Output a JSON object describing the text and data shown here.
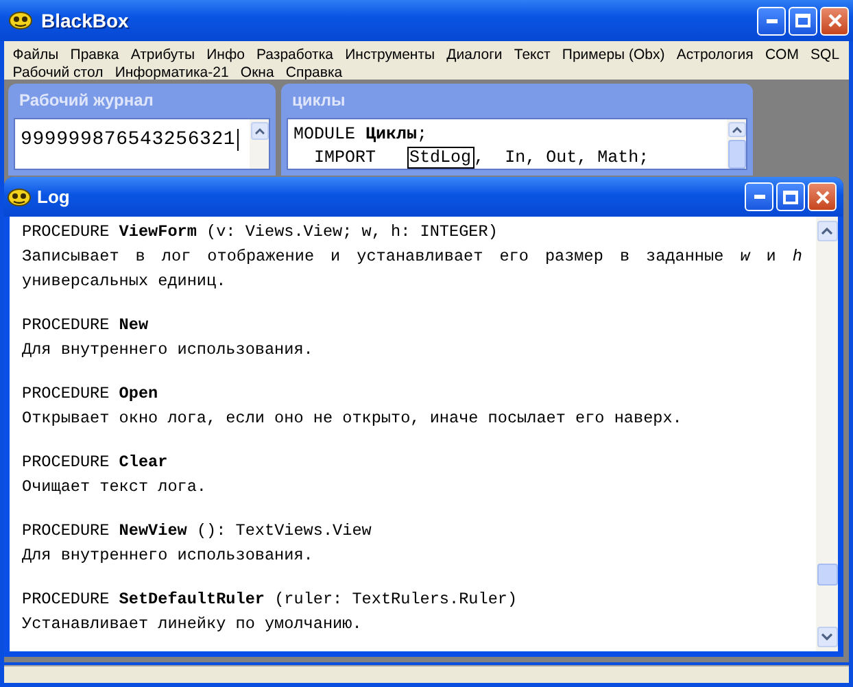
{
  "window": {
    "title": "BlackBox"
  },
  "menu": [
    {
      "label": "Файлы"
    },
    {
      "label": "Правка"
    },
    {
      "label": "Атрибуты"
    },
    {
      "label": "Инфо"
    },
    {
      "label": "Разработка"
    },
    {
      "label": "Инструменты"
    },
    {
      "label": "Диалоги"
    },
    {
      "label": "Текст"
    },
    {
      "label": "Примеры (Obx)"
    },
    {
      "label": "Астрология"
    },
    {
      "label": "COM"
    },
    {
      "label": "SQL"
    },
    {
      "label": "Рабочий стол"
    },
    {
      "label": "Информатика-21"
    },
    {
      "label": "Окна"
    },
    {
      "label": "Справка"
    }
  ],
  "journal": {
    "title": "Рабочий журнал",
    "value": "999999876543256321"
  },
  "cycles": {
    "title": "циклы",
    "lines": [
      {
        "kind": "plain",
        "text": "MODULE **Циклы**;"
      },
      {
        "kind": "import",
        "keyword": "IMPORT",
        "boxed": "StdLog",
        "rest": ",  In, Out, Math;"
      }
    ]
  },
  "log": {
    "title": "Log",
    "entries": [
      {
        "head": "PROCEDURE **ViewForm** (v: Views.View; w, h: INTEGER)",
        "description": "Записывает в лог отображение и устанавливает его размер в заданные *w* и *h* универсальных единиц."
      },
      {
        "head": "PROCEDURE **New**",
        "description": "Для внутреннего использования."
      },
      {
        "head": "PROCEDURE **Open**",
        "description": "Открывает окно лога, если оно не открыто, иначе посылает его наверх."
      },
      {
        "head": "PROCEDURE **Clear**",
        "description": "Очищает текст лога."
      },
      {
        "head": "PROCEDURE **NewView** (): TextViews.View",
        "description": "Для внутреннего использования."
      },
      {
        "head": "PROCEDURE **SetDefaultRuler** (ruler: TextRulers.Ruler)",
        "description": "Устанавливает линейку по умолчанию."
      }
    ]
  }
}
